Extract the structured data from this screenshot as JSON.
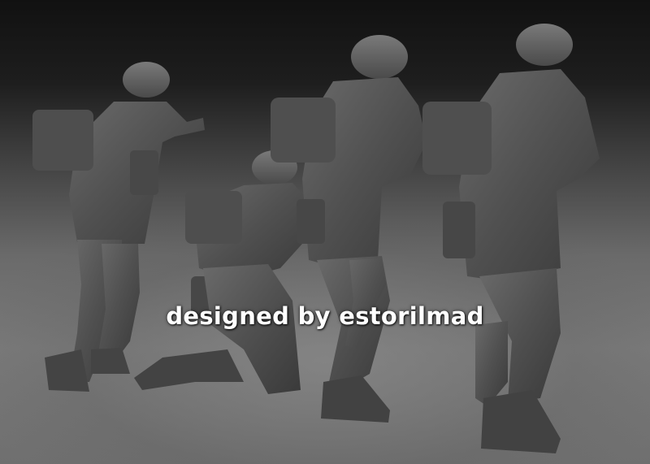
{
  "watermark": {
    "text": "designed by estorilmad"
  },
  "scene": {
    "subject": "four soldier figurines",
    "colors": {
      "figure": "#555555",
      "figure_dark": "#3a3a3a",
      "figure_light": "#6e6e6e",
      "text": "#ffffff"
    }
  }
}
